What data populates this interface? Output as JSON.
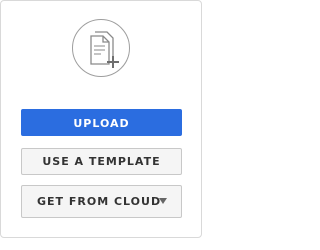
{
  "panel": {
    "icon": "new-document-icon",
    "upload_label": "UPLOAD",
    "template_label": "USE A TEMPLATE",
    "cloud_label": "GET FROM CLOUD",
    "cloud_caret_icon": "caret-down-icon"
  },
  "colors": {
    "primary": "#2b6de0",
    "secondary_bg": "#f5f5f5",
    "border": "#c8c8c8",
    "icon_gray": "#9e9e9e"
  }
}
